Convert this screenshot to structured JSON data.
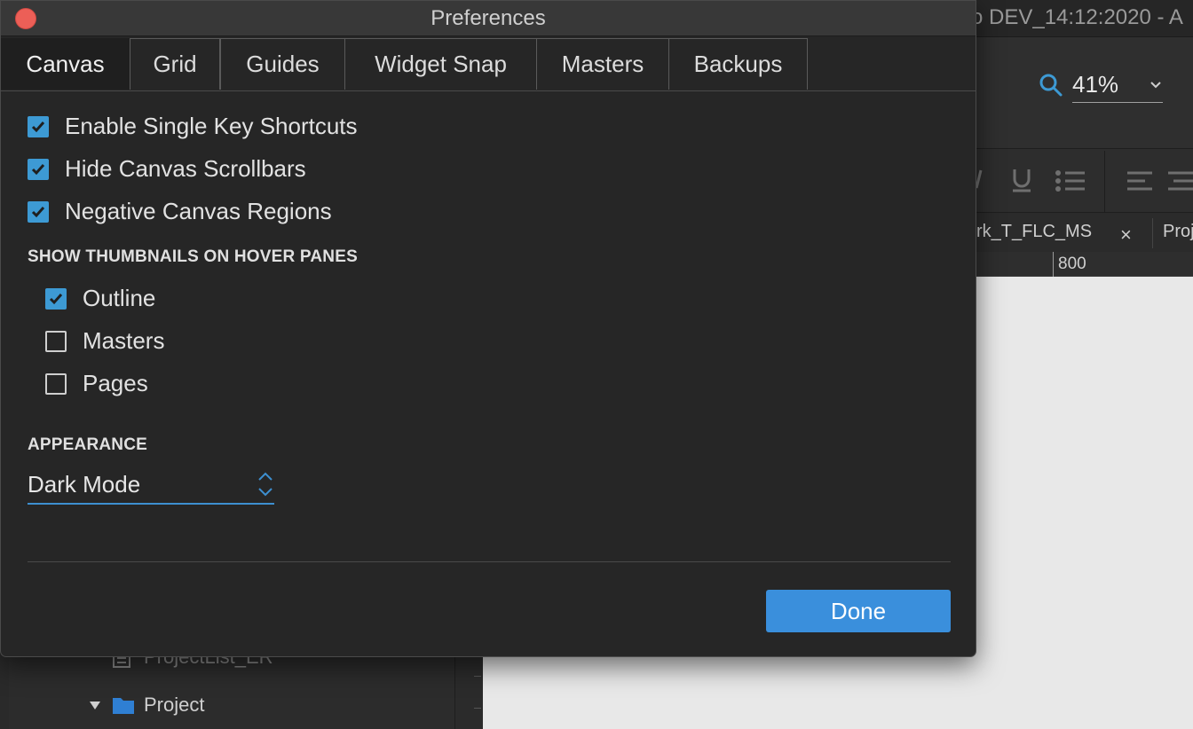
{
  "background_window": {
    "title_fragment": "o DEV_14:12:2020 - A",
    "zoom_value": "41%",
    "doc_tab_fragment": "rk_T_FLC_MS",
    "doc_tab_close": "×",
    "doc_tab_next_fragment": "Proj",
    "ruler_label": "800",
    "tree_items": [
      {
        "label": "ProjectList_ER",
        "icon": "page-icon"
      },
      {
        "label": "Project",
        "icon": "folder-icon"
      }
    ]
  },
  "dialog": {
    "title": "Preferences",
    "tabs": [
      {
        "label": "Canvas",
        "active": true
      },
      {
        "label": "Grid",
        "active": false
      },
      {
        "label": "Guides",
        "active": false
      },
      {
        "label": "Widget Snap",
        "active": false
      },
      {
        "label": "Masters",
        "active": false
      },
      {
        "label": "Backups",
        "active": false
      }
    ],
    "options": [
      {
        "label": "Enable Single Key Shortcuts",
        "checked": true
      },
      {
        "label": "Hide Canvas Scrollbars",
        "checked": true
      },
      {
        "label": "Negative Canvas Regions",
        "checked": true
      }
    ],
    "thumbnails_heading": "SHOW THUMBNAILS ON HOVER PANES",
    "thumbnail_options": [
      {
        "label": "Outline",
        "checked": true
      },
      {
        "label": "Masters",
        "checked": false
      },
      {
        "label": "Pages",
        "checked": false
      }
    ],
    "appearance_heading": "APPEARANCE",
    "appearance_value": "Dark Mode",
    "done_label": "Done"
  },
  "colors": {
    "accent": "#3d9ad4",
    "button": "#3a8fdc",
    "close": "#ec5f57"
  }
}
